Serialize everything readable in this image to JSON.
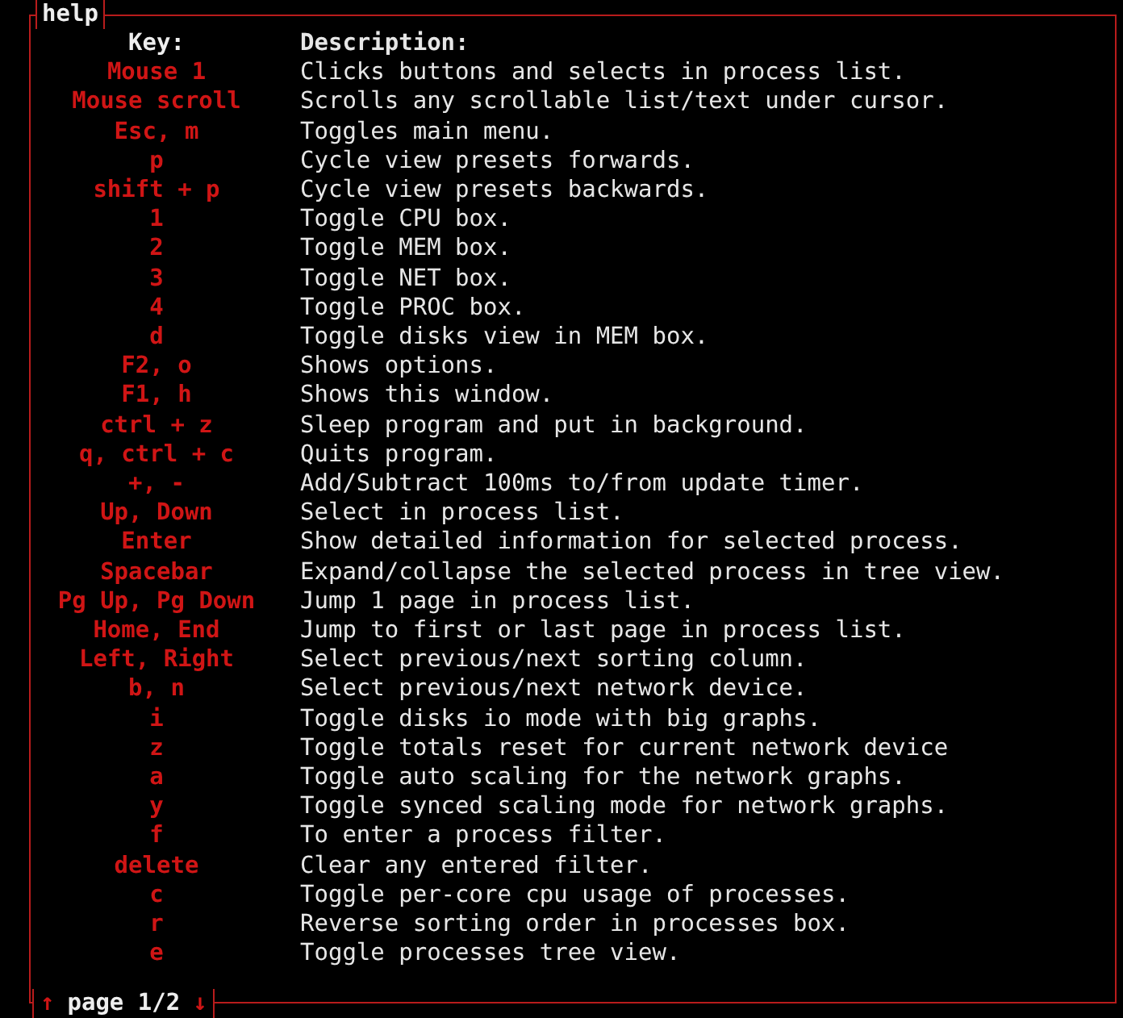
{
  "window": {
    "title": "help"
  },
  "table": {
    "columns": [
      "Key:",
      "Description:"
    ],
    "rows": [
      {
        "key": "Mouse 1",
        "description": "Clicks buttons and selects in process list."
      },
      {
        "key": "Mouse scroll",
        "description": "Scrolls any scrollable list/text under cursor."
      },
      {
        "key": "Esc, m",
        "description": "Toggles main menu."
      },
      {
        "key": "p",
        "description": "Cycle view presets forwards."
      },
      {
        "key": "shift + p",
        "description": "Cycle view presets backwards."
      },
      {
        "key": "1",
        "description": "Toggle CPU box."
      },
      {
        "key": "2",
        "description": "Toggle MEM box."
      },
      {
        "key": "3",
        "description": "Toggle NET box."
      },
      {
        "key": "4",
        "description": "Toggle PROC box."
      },
      {
        "key": "d",
        "description": "Toggle disks view in MEM box."
      },
      {
        "key": "F2, o",
        "description": "Shows options."
      },
      {
        "key": "F1, h",
        "description": "Shows this window."
      },
      {
        "key": "ctrl + z",
        "description": "Sleep program and put in background."
      },
      {
        "key": "q, ctrl + c",
        "description": "Quits program."
      },
      {
        "key": "+, -",
        "description": "Add/Subtract 100ms to/from update timer."
      },
      {
        "key": "Up, Down",
        "description": "Select in process list."
      },
      {
        "key": "Enter",
        "description": "Show detailed information for selected process."
      },
      {
        "key": "Spacebar",
        "description": "Expand/collapse the selected process in tree view."
      },
      {
        "key": "Pg Up, Pg Down",
        "description": "Jump 1 page in process list."
      },
      {
        "key": "Home, End",
        "description": "Jump to first or last page in process list."
      },
      {
        "key": "Left, Right",
        "description": "Select previous/next sorting column."
      },
      {
        "key": "b, n",
        "description": "Select previous/next network device."
      },
      {
        "key": "i",
        "description": "Toggle disks io mode with big graphs."
      },
      {
        "key": "z",
        "description": "Toggle totals reset for current network device"
      },
      {
        "key": "a",
        "description": "Toggle auto scaling for the network graphs."
      },
      {
        "key": "y",
        "description": "Toggle synced scaling mode for network graphs."
      },
      {
        "key": "f",
        "description": "To enter a process filter."
      },
      {
        "key": "delete",
        "description": "Clear any entered filter."
      },
      {
        "key": "c",
        "description": "Toggle per-core cpu usage of processes."
      },
      {
        "key": "r",
        "description": "Reverse sorting order in processes box."
      },
      {
        "key": "e",
        "description": "Toggle processes tree view."
      }
    ]
  },
  "footer": {
    "up": "↑",
    "page": "page 1/2",
    "down": "↓"
  }
}
